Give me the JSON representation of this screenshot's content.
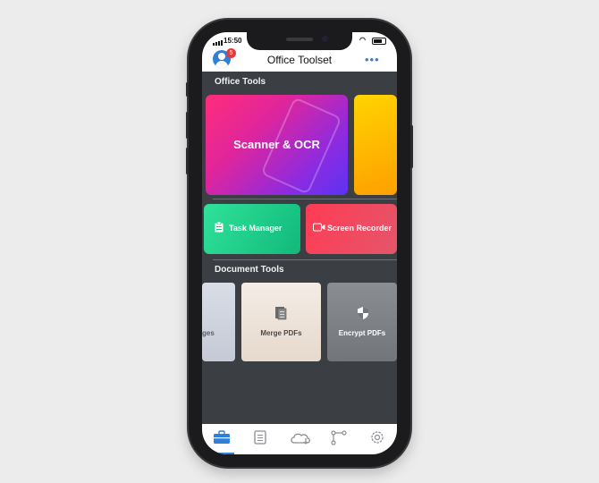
{
  "status": {
    "time": "15:50"
  },
  "nav": {
    "title": "Office Toolset",
    "badge_count": "5",
    "more_label": "•••"
  },
  "sections": {
    "office_tools": "Office Tools",
    "document_tools": "Document Tools"
  },
  "office_tools": {
    "scanner": {
      "label": "Scanner & OCR"
    },
    "task_manager": {
      "label": "Task Manager",
      "icon": "clipboard-icon"
    },
    "screen_recorder": {
      "label": "Screen Recorder",
      "icon": "video-camera-icon"
    }
  },
  "document_tools": [
    {
      "label": "ges"
    },
    {
      "label": "Merge PDFs",
      "icon": "merge-document-icon"
    },
    {
      "label": "Encrypt PDFs",
      "icon": "shield-icon"
    }
  ],
  "tabbar": {
    "active": "toolbox",
    "items": [
      "toolbox-icon",
      "notes-icon",
      "cloud-icon",
      "connection-icon",
      "settings-icon"
    ]
  },
  "colors": {
    "accent": "#2f7fd9",
    "badge": "#e23b3b",
    "screen_bg": "#3b3e42"
  }
}
